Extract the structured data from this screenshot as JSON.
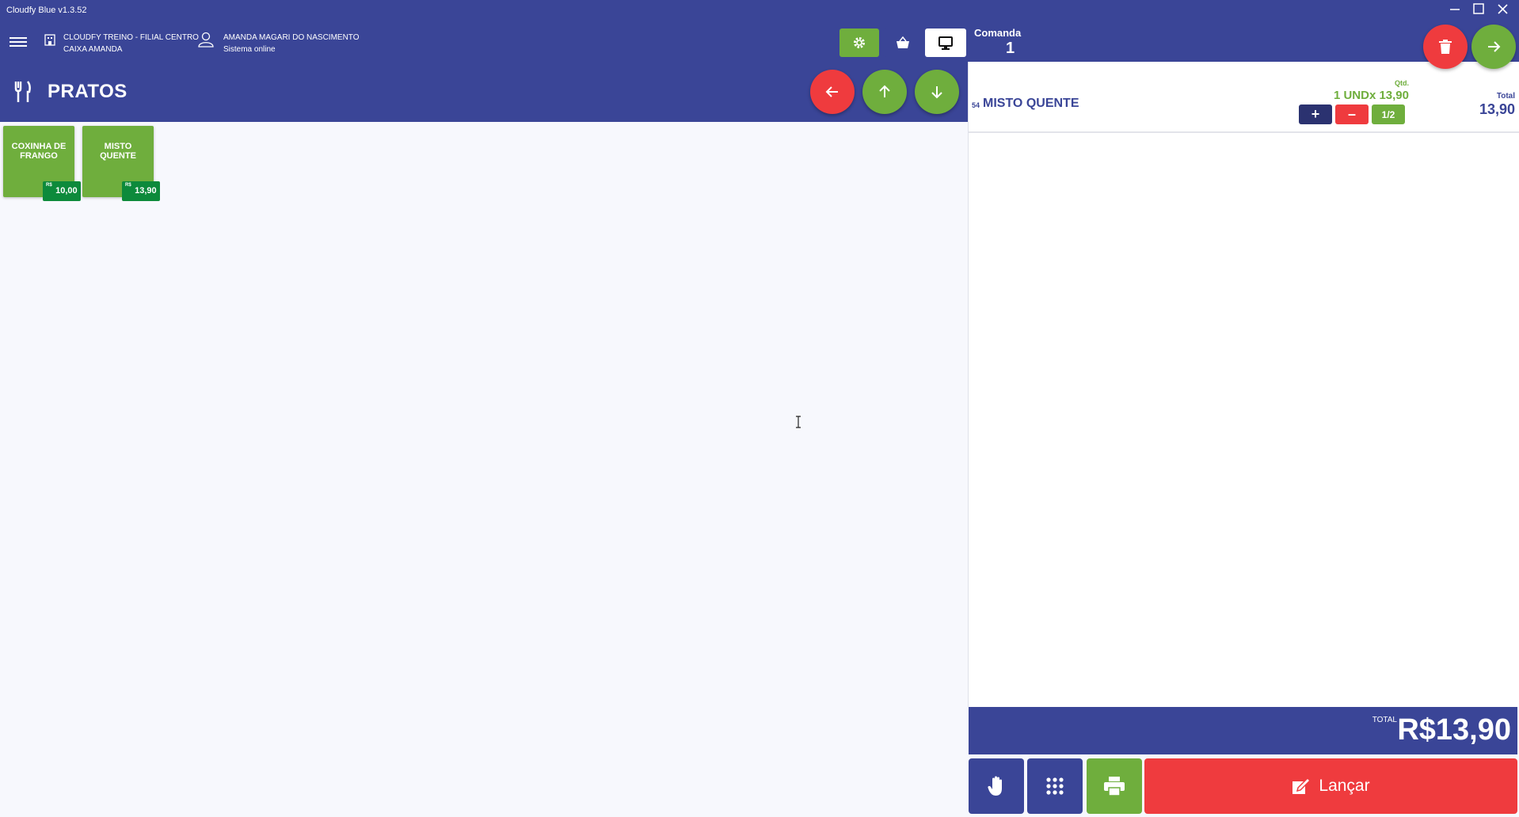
{
  "window": {
    "title": "Cloudfy Blue v1.3.52"
  },
  "header": {
    "store_line1": "CLOUDFY TREINO - FILIAL CENTRO",
    "store_line2": "CAIXA AMANDA",
    "user_name": "AMANDA MAGARI DO NASCIMENTO",
    "user_status": "Sistema online",
    "section_title": "PRATOS",
    "comanda_label": "Comanda",
    "comanda_number": "1"
  },
  "products": [
    {
      "name": "COXINHA DE FRANGO",
      "currency": "R$",
      "price": "10,00"
    },
    {
      "name": "MISTO QUENTE",
      "currency": "R$",
      "price": "13,90"
    }
  ],
  "order": {
    "items": [
      {
        "code": "54",
        "name": "MISTO QUENTE",
        "qtd_label": "Qtd.",
        "qtd_value": "1 UNDx 13,90",
        "plus": "+",
        "minus": "–",
        "half": "1/2",
        "total_label": "Total",
        "total_value": "13,90"
      }
    ],
    "total_label": "TOTAL",
    "total_value": "R$13,90"
  },
  "footer": {
    "launch_label": "Lançar"
  },
  "colors": {
    "primary": "#3a4597",
    "green": "#6fae3d",
    "dark_green": "#0d8a3b",
    "red": "#ef3b3e",
    "navy": "#2b3270"
  }
}
